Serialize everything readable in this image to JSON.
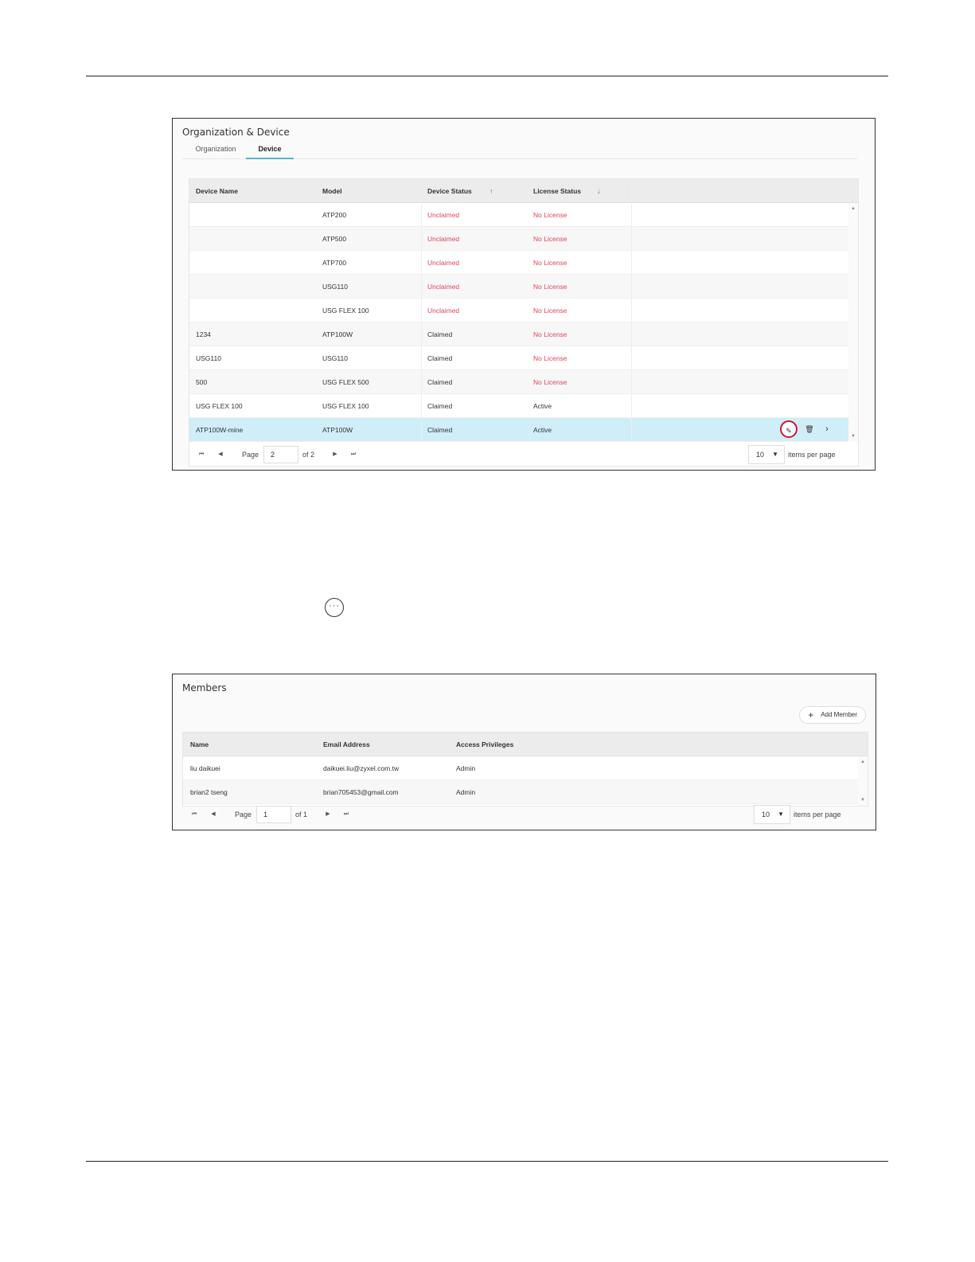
{
  "device_panel": {
    "title": "Organization & Device",
    "tabs": [
      {
        "label": "Organization",
        "active": false
      },
      {
        "label": "Device",
        "active": true
      }
    ],
    "columns": [
      "Device Name",
      "Model",
      "Device Status",
      "License Status"
    ],
    "sort_icons": {
      "device_status": "↑",
      "license_status": "↓"
    },
    "rows": [
      {
        "name": "",
        "model": "ATP200",
        "status": "Unclaimed",
        "license": "No License"
      },
      {
        "name": "",
        "model": "ATP500",
        "status": "Unclaimed",
        "license": "No License"
      },
      {
        "name": "",
        "model": "ATP700",
        "status": "Unclaimed",
        "license": "No License"
      },
      {
        "name": "",
        "model": "USG110",
        "status": "Unclaimed",
        "license": "No License"
      },
      {
        "name": "",
        "model": "USG FLEX 100",
        "status": "Unclaimed",
        "license": "No License"
      },
      {
        "name": "1234",
        "model": "ATP100W",
        "status": "Claimed",
        "license": "No License"
      },
      {
        "name": "USG110",
        "model": "USG110",
        "status": "Claimed",
        "license": "No License"
      },
      {
        "name": "500",
        "model": "USG FLEX 500",
        "status": "Claimed",
        "license": "No License"
      },
      {
        "name": "USG FLEX 100",
        "model": "USG FLEX 100",
        "status": "Claimed",
        "license": "Active"
      },
      {
        "name": "ATP100W-mine",
        "model": "ATP100W",
        "status": "Claimed",
        "license": "Active",
        "selected": true
      }
    ],
    "pager": {
      "page_label": "Page",
      "page": "2",
      "of_label": "of 2",
      "per_page": "10",
      "per_page_label": "items per page"
    }
  },
  "more_icon": {
    "glyph": "···",
    "icon": "more-horizontal-icon"
  },
  "members_panel": {
    "title": "Members",
    "add_button": "Add Member",
    "columns": [
      "Name",
      "Email Address",
      "Access Privileges"
    ],
    "rows": [
      {
        "name": "liu daikuei",
        "email": "daikuei.liu@zyxel.com.tw",
        "access": "Admin"
      },
      {
        "name": "brian2 tseng",
        "email": "brian705453@gmail.com",
        "access": "Admin"
      }
    ],
    "pager": {
      "page_label": "Page",
      "page": "1",
      "of_label": "of 1",
      "per_page": "10",
      "per_page_label": "items per page"
    }
  },
  "colors": {
    "unclaimed_red": "#e0455b",
    "selected_row": "#cfeef8",
    "tab_underline": "#4bb8d4",
    "highlight_circle": "#d0182c",
    "sort_arrow": "#2b7cd3"
  }
}
